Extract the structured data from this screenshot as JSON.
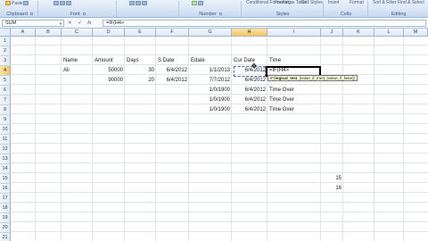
{
  "ribbon": {
    "buttons": [
      "Paste",
      "Format Painter",
      "Conditional Formatting",
      "Format as Table",
      "Cell Styles",
      "Insert",
      "Format",
      "Sort & Filter",
      "Find & Select"
    ],
    "groups": [
      "Clipboard",
      "Font",
      "Number",
      "Styles",
      "Cells",
      "Editing"
    ]
  },
  "formula_bar": {
    "name_box": "SUM",
    "icons": [
      "cancel-icon",
      "enter-icon",
      "function-icon"
    ],
    "formula": "=IF(H4>"
  },
  "columns": [
    "A",
    "B",
    "C",
    "D",
    "E",
    "F",
    "G",
    "H",
    "I",
    "J",
    "K",
    "L",
    "M"
  ],
  "rows": [
    "1",
    "2",
    "3",
    "4",
    "5",
    "6",
    "7",
    "8",
    "9",
    "10",
    "11",
    "12",
    "13",
    "14",
    "15",
    "16",
    "17",
    "18",
    "19",
    "20",
    "21"
  ],
  "active_row": "4",
  "active_col": "H",
  "cells": {
    "C3": "Name",
    "D3": "Amount",
    "E3": "Days",
    "F3": "S Date",
    "G3": "Edate",
    "H3": "Cur Date",
    "I3": "Time",
    "C4": "Ali",
    "D4": "50000",
    "E4": "30",
    "F4": "6/4/2012",
    "G4": "1/1/2013",
    "H4": "6/4/2012",
    "I4": "=IF(H4>",
    "D5": "90000",
    "E5": "20",
    "F5": "6/4/2012",
    "G5": "7/7/2012",
    "H5": "6/4/2012",
    "I5": "N",
    "G6": "1/0/1900",
    "H6": "6/4/2012",
    "I6": "Time Over",
    "G7": "1/0/1900",
    "H7": "6/4/2012",
    "I7": "Time Over",
    "G8": "1/0/1900",
    "H8": "6/4/2012",
    "I8": "Time Over",
    "J15": "15",
    "J16": "16"
  },
  "tooltip": {
    "fn": "IF(",
    "arg1": "logical_test",
    "rest": ", [value_if_true], [value_if_false])"
  },
  "colors": {
    "ribbon_bg": "#d9e6f6",
    "header_sel": "#f4c462",
    "grid": "#dde4ee"
  }
}
